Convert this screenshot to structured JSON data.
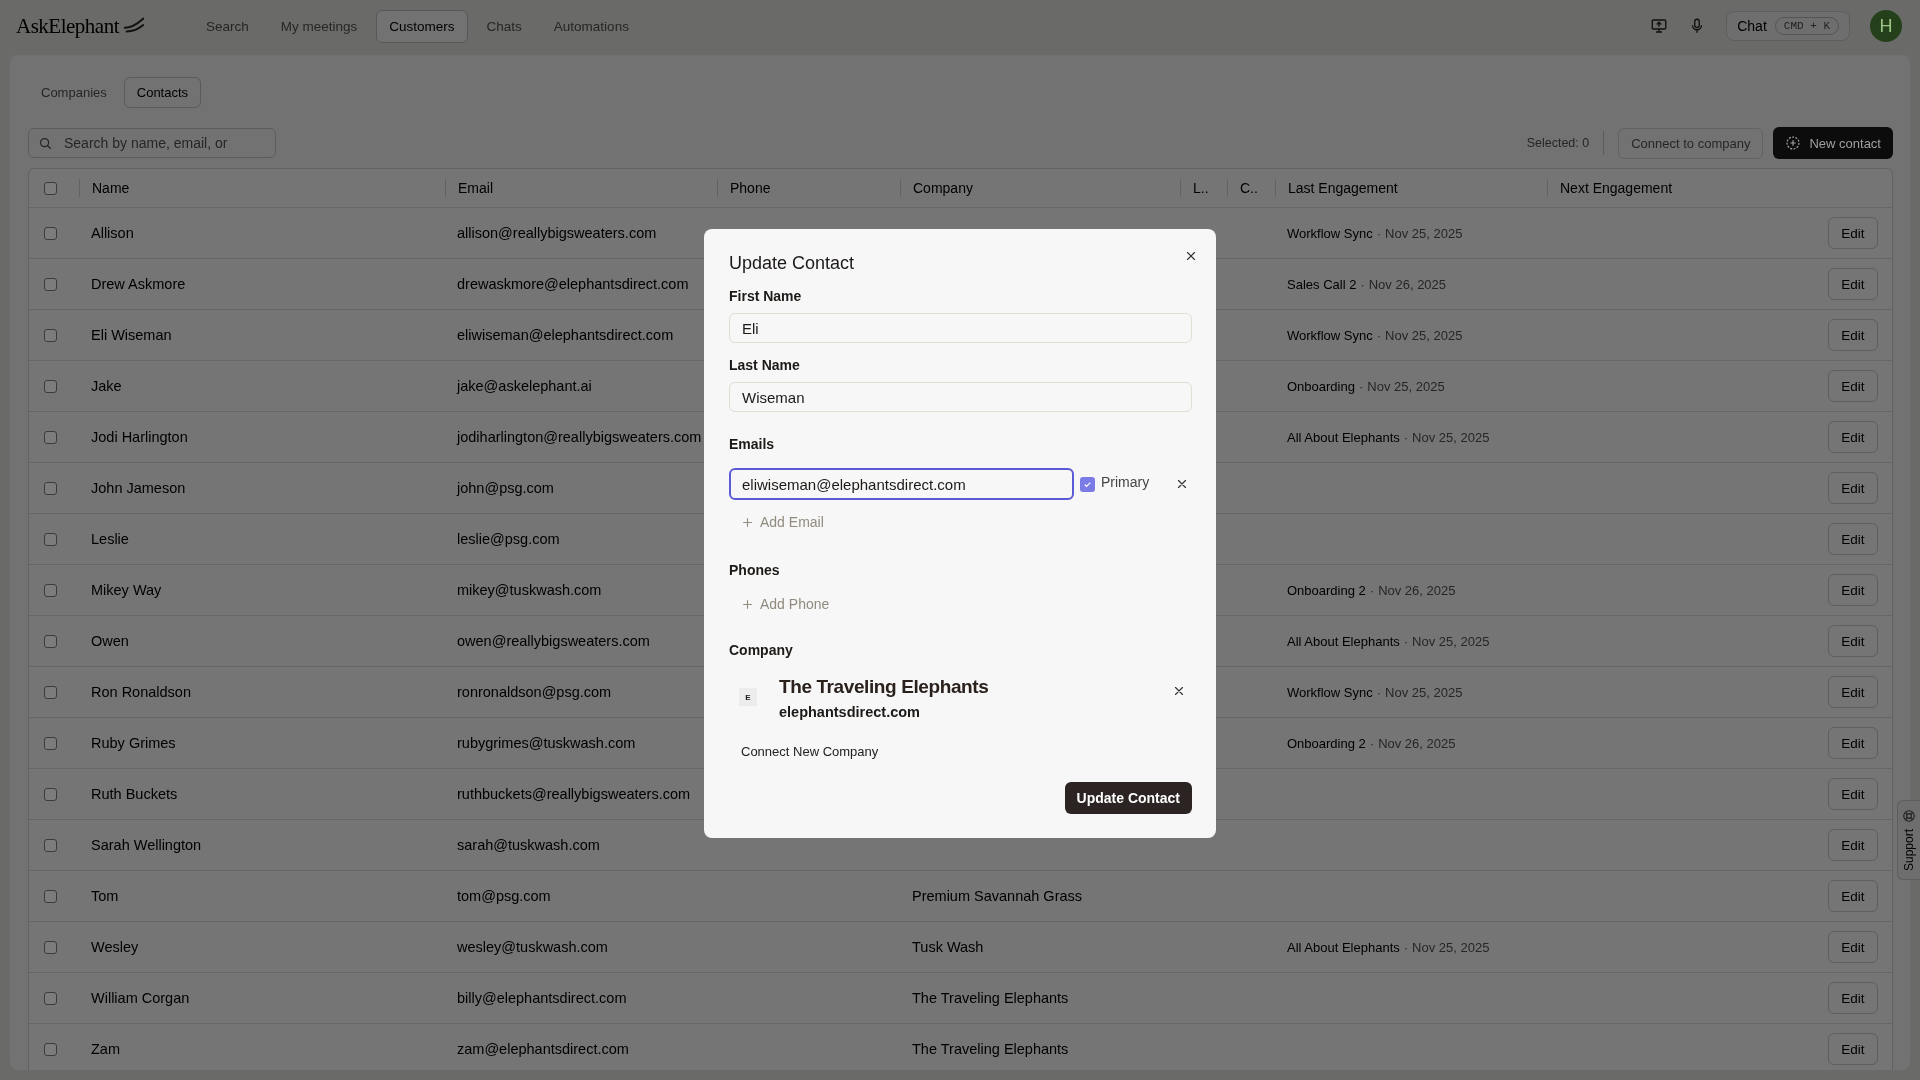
{
  "app": {
    "logo": "AskElephant",
    "nav": [
      {
        "label": "Search",
        "selected": false
      },
      {
        "label": "My meetings",
        "selected": false
      },
      {
        "label": "Customers",
        "selected": true
      },
      {
        "label": "Chats",
        "selected": false
      },
      {
        "label": "Automations",
        "selected": false
      }
    ],
    "chat_button": {
      "label": "Chat",
      "shortcut": "CMD + K"
    },
    "avatar": "H"
  },
  "subtabs": [
    {
      "label": "Companies",
      "selected": false
    },
    {
      "label": "Contacts",
      "selected": true
    }
  ],
  "search": {
    "placeholder": "Search by name, email, or"
  },
  "selected_count": "Selected: 0",
  "connect_button": "Connect to company",
  "new_button": "New contact",
  "table": {
    "select_all": false,
    "columns": [
      "Name",
      "Email",
      "Phone",
      "Company",
      "L..",
      "C..",
      "Last Engagement",
      "Next Engagement"
    ],
    "rows": [
      {
        "name": "Allison",
        "email": "allison@reallybigsweaters.com",
        "checked": false,
        "last": {
          "meeting": "Workflow Sync",
          "separator": "·",
          "date": "Nov 25, 2025"
        },
        "edit": "Edit"
      },
      {
        "name": "Drew Askmore",
        "email": "drewaskmore@elephantsdirect.com",
        "checked": false,
        "last": {
          "meeting": "Sales Call 2",
          "separator": "·",
          "date": "Nov 26, 2025"
        },
        "edit": "Edit"
      },
      {
        "name": "Eli Wiseman",
        "email": "eliwiseman@elephantsdirect.com",
        "checked": false,
        "last": {
          "meeting": "Workflow Sync",
          "separator": "·",
          "date": "Nov 25, 2025"
        },
        "edit": "Edit"
      },
      {
        "name": "Jake",
        "email": "jake@askelephant.ai",
        "checked": false,
        "last": {
          "meeting": "Onboarding",
          "separator": "·",
          "date": "Nov 25, 2025"
        },
        "edit": "Edit"
      },
      {
        "name": "Jodi Harlington",
        "email": "jodiharlington@reallybigsweaters.com",
        "checked": false,
        "last": {
          "meeting": "All About Elephants",
          "separator": "·",
          "date": "Nov 25, 2025"
        },
        "edit": "Edit"
      },
      {
        "name": "John Jameson",
        "email": "john@psg.com",
        "checked": false,
        "edit": "Edit"
      },
      {
        "name": "Leslie",
        "email": "leslie@psg.com",
        "checked": false,
        "edit": "Edit"
      },
      {
        "name": "Mikey Way",
        "email": "mikey@tuskwash.com",
        "checked": false,
        "last": {
          "meeting": "Onboarding 2",
          "separator": "·",
          "date": "Nov 26, 2025"
        },
        "edit": "Edit"
      },
      {
        "name": "Owen",
        "email": "owen@reallybigsweaters.com",
        "checked": false,
        "last": {
          "meeting": "All About Elephants",
          "separator": "·",
          "date": "Nov 25, 2025"
        },
        "edit": "Edit"
      },
      {
        "name": "Ron Ronaldson",
        "email": "ronronaldson@psg.com",
        "checked": false,
        "last": {
          "meeting": "Workflow Sync",
          "separator": "·",
          "date": "Nov 25, 2025"
        },
        "edit": "Edit"
      },
      {
        "name": "Ruby Grimes",
        "email": "rubygrimes@tuskwash.com",
        "checked": false,
        "last": {
          "meeting": "Onboarding 2",
          "separator": "·",
          "date": "Nov 26, 2025"
        },
        "edit": "Edit"
      },
      {
        "name": "Ruth Buckets",
        "email": "ruthbuckets@reallybigsweaters.com",
        "checked": false,
        "edit": "Edit"
      },
      {
        "name": "Sarah Wellington",
        "email": "sarah@tuskwash.com",
        "checked": false,
        "edit": "Edit"
      },
      {
        "name": "Tom",
        "email": "tom@psg.com",
        "checked": false,
        "company": "Premium Savannah Grass",
        "edit": "Edit"
      },
      {
        "name": "Wesley",
        "email": "wesley@tuskwash.com",
        "checked": false,
        "company": "Tusk Wash",
        "last": {
          "meeting": "All About Elephants",
          "separator": "·",
          "date": "Nov 25, 2025"
        },
        "edit": "Edit"
      },
      {
        "name": "William Corgan",
        "email": "billy@elephantsdirect.com",
        "checked": false,
        "company": "The Traveling Elephants",
        "edit": "Edit"
      },
      {
        "name": "Zam",
        "email": "zam@elephantsdirect.com",
        "checked": false,
        "company": "The Traveling Elephants",
        "edit": "Edit"
      }
    ]
  },
  "modal": {
    "title": "Update Contact",
    "first_name": {
      "label": "First Name",
      "value": "Eli"
    },
    "last_name": {
      "label": "Last Name",
      "value": "Wiseman"
    },
    "emails_label": "Emails",
    "emails": [
      {
        "value": "eliwiseman@elephantsdirect.com",
        "focused": true,
        "primary": true,
        "primary_label": "Primary"
      }
    ],
    "add_email": "Add Email",
    "phones_label": "Phones",
    "add_phone": "Add Phone",
    "company_label": "Company",
    "company": {
      "initial": "E",
      "name": "The Traveling Elephants",
      "domain": "elephantsdirect.com"
    },
    "connect_company": "Connect New Company",
    "submit": "Update Contact"
  },
  "support_tab": "Support"
}
